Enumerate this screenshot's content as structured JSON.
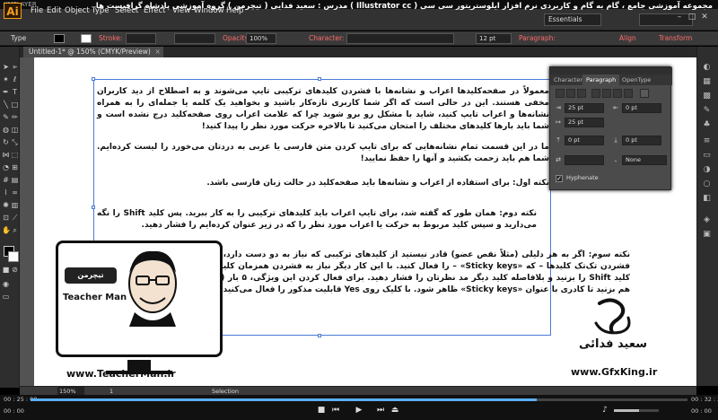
{
  "player": {
    "title": "KMPLAYER",
    "time_elapsed": "00 : 25 : 00",
    "time_total": "00 : 32 : 24",
    "progress_fraction": 0.77,
    "volume_fraction": 0.55,
    "time_left_label": "00 : 00",
    "time_right_label": "00 : 00"
  },
  "app": {
    "logo": "Ai",
    "title": "مجموعه آموزشی جامع ، گام به گام و کاربردی نرم افزار ایلوستریتور سی سی ( Illustrator cc )   مدرس : سعید فدایی ( تیچرمن ) گروه آموزشی پادشاه گرافیست ها",
    "menus": [
      "File",
      "Edit",
      "Object",
      "Type",
      "Select",
      "Effect",
      "View",
      "Window",
      "Help"
    ],
    "workspace": "Essentials",
    "window_buttons": [
      "–",
      "□",
      "✕"
    ]
  },
  "control_bar": {
    "type_label": "Type",
    "stroke_label": "Stroke:",
    "opacity_label": "Opacity:",
    "opacity_value": "100%",
    "character_label": "Character:",
    "font_size": "12 pt",
    "paragraph_label": "Paragraph:",
    "align_label": "Align",
    "transform_label": "Transform"
  },
  "document": {
    "tab_label": "Untitled-1* @ 150% (CMYK/Preview)",
    "tab_close": "×"
  },
  "status": {
    "zoom": "150%",
    "page": "1",
    "mode": "Selection"
  },
  "paragraphs": [
    "معمولاً در صفحه‌کلیدها اعراب و نشانه‌ها با فشردن کلیدهای ترکیبی تایپ می‌شوند و به اصطلاح از دید کاربران مخفی هستند. این در حالی است که اگر شما کاربری تازه‌کار باشید و بخواهید یک کلمه یا جمله‌ای را به همراه نشانه‌ها و اعراب تایپ کنید، شاید با مشکل رو برو شوید چرا که علامت اعراب روی صفحه‌کلید درج نشده است و شما باید بارها کلیدهای مختلف را امتحان می‌کنید تا بالاخره حرکت مورد نظر را پیدا کنید!",
    "ما در این قسمت تمام نشانه‌هایی که برای تایپ کردن متن فارسی یا عربی به دردتان می‌خورد را لیست کرده‌ایم. شما هم باید زحمت بکشید و آنها را حفظ نمایید!",
    "نکته اول: برای استفاده از اعراب و نشانه‌ها باید صفحه‌کلید در حالت زبان فارسی باشد.",
    "نکته دوم: همان طور که گفته شد، برای تایپ اعراب باید کلیدهای ترکیبی را به کار ببرید. پس کلید Shift را نگه می‌دارید و سپس کلید مربوط به حرکت یا اعراب مورد نظر را که در زیر عنوان کرده‌ایم را فشار دهید.",
    "نکته سوم: اگر به هر دلیلی (مثلاً نقص عضو) قادر نیستید از کلیدهای ترکیبی که نیاز به دو دست دارد، استفاده کنید، می‌توانید قابلیت فشردن تک‌تک کلیدها – که «Sticky keys» – را فعال کنید. با این کار دیگر نیاز به فشردن همزمان کلیدها نیست و شما می‌توانید ابتدا کلید Shift را بزنید و بلافاصله کلید دیگر مد نظرتان را فشار دهید. برای فعال کردن این ویژگی، ۵ بار (پنج بار) کلید Shift را پشت سر هم بزنید تا کادری با عنوان «Sticky keys» ظاهر شود. با کلیک روی Yes قابلیت مذکور را فعال می‌کنید."
  ],
  "panel": {
    "tabs": [
      "Character",
      "Paragraph",
      "OpenType"
    ],
    "active_tab": "Paragraph",
    "indent_left": "25 pt",
    "indent_right": "0 pt",
    "first_line": "25 pt",
    "space_before": "0 pt",
    "space_after": "0 pt",
    "kashida": "None",
    "hyphenate_label": "Hyphenate",
    "hyphenate_checked": true
  },
  "watermarks": {
    "teacherman_logo": "تیچرمن",
    "teacherman_name": "Teacher Man",
    "teacherman_url": "www.TeacherMan.ir",
    "gfxking_name": "سعید فدائی",
    "gfxking_url": "www.GfxKing.ir"
  }
}
